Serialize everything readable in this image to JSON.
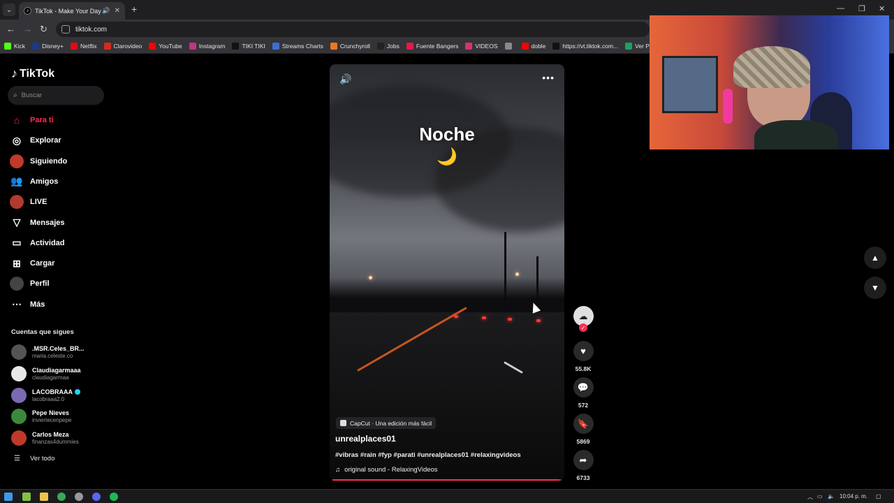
{
  "browser": {
    "tab": {
      "title": "TikTok - Make Your Day"
    },
    "address": "tiktok.com",
    "bookmarks": [
      {
        "label": "Kick",
        "color": "#53fc18"
      },
      {
        "label": "Disney+",
        "color": "#1a3a8a"
      },
      {
        "label": "Netflix",
        "color": "#e50914"
      },
      {
        "label": "Clarovideo",
        "color": "#d52b1e"
      },
      {
        "label": "YouTube",
        "color": "#ff0000"
      },
      {
        "label": "Instagram",
        "color": "#c13584"
      },
      {
        "label": "TIKI TIKI",
        "color": "#111111"
      },
      {
        "label": "Streams Charts",
        "color": "#3b6fd8"
      },
      {
        "label": "Crunchyroll",
        "color": "#f47521"
      },
      {
        "label": "Jobs",
        "color": "#222222"
      },
      {
        "label": "Fuente Bangers",
        "color": "#e6194b"
      },
      {
        "label": "VIDEOS",
        "color": "#d6336c"
      },
      {
        "label": "",
        "color": "#888888"
      },
      {
        "label": "doble",
        "color": "#ff0000"
      },
      {
        "label": "https://vt.tiktok.com...",
        "color": "#111111"
      },
      {
        "label": "Ver Patch Au",
        "color": "#1aa260"
      }
    ]
  },
  "sidebar": {
    "logo": "TikTok",
    "search_placeholder": "Buscar",
    "nav": [
      {
        "label": "Para ti",
        "icon": "home-icon",
        "active": true
      },
      {
        "label": "Explorar",
        "icon": "compass-icon"
      },
      {
        "label": "Siguiendo",
        "icon": "following-avatar-icon"
      },
      {
        "label": "Amigos",
        "icon": "friends-icon"
      },
      {
        "label": "LIVE",
        "icon": "live-avatar-icon"
      },
      {
        "label": "Mensajes",
        "icon": "send-icon"
      },
      {
        "label": "Actividad",
        "icon": "activity-icon"
      },
      {
        "label": "Cargar",
        "icon": "upload-icon"
      },
      {
        "label": "Perfil",
        "icon": "profile-avatar-icon"
      },
      {
        "label": "Más",
        "icon": "more-icon"
      }
    ],
    "following_title": "Cuentas que sigues",
    "following": [
      {
        "name": ".MSR.Celes_BR...",
        "handle": "maria.celeste.co",
        "color": "#555555"
      },
      {
        "name": "Claudiagarmaaa",
        "handle": "claudiagarmaa",
        "color": "#e8e8e8"
      },
      {
        "name": "LACOBRAAA",
        "handle": "lacobraaa2.0",
        "color": "#7a6ab0",
        "verified": true
      },
      {
        "name": "Pepe Nieves",
        "handle": "inviertecenpepe",
        "color": "#3b8a3b"
      },
      {
        "name": "Carlos Meza",
        "handle": "finanzas4dummies",
        "color": "#c0392b"
      }
    ],
    "see_all": "Ver todo"
  },
  "video": {
    "overlay_title": "Noche",
    "overlay_emoji": "🌙",
    "capcut_label": "CapCut · Una edición más fácil",
    "author": "unrealplaces01",
    "description": "#vibras #rain #fyp #parati #unrealplaces01 #relaxingvideos",
    "sound": "original sound - RelaxingVideos"
  },
  "actions": {
    "likes": "55.8K",
    "comments": "572",
    "saves": "5869",
    "shares": "6733"
  },
  "taskbar": {
    "clock": "10:04 p. m."
  }
}
